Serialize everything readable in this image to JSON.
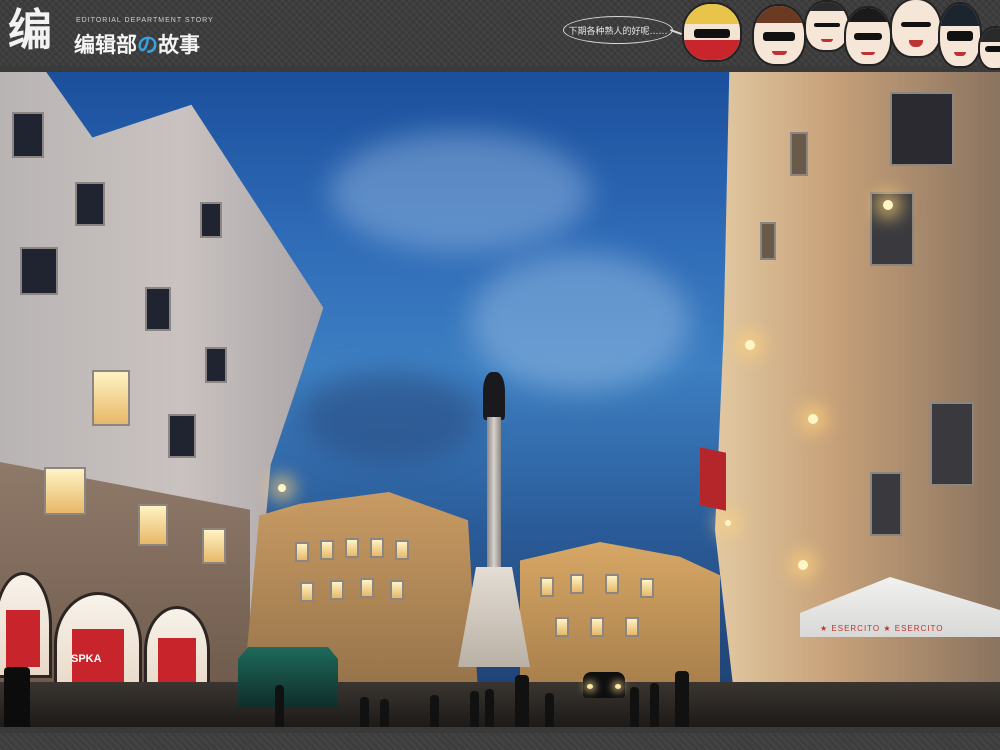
{
  "header": {
    "logo_glyph": "编",
    "logo_subtitle": "EDITORIAL DEPARTMENT STORY",
    "logo_name_part1": "编辑部",
    "logo_name_accent": "の",
    "logo_name_part2": "故事",
    "speech_bubble": "下期各种熟人的好呢……",
    "avatars": [
      {
        "name": "avatar-red-scarf-icon",
        "hair": "#e8c44a"
      },
      {
        "name": "avatar-glasses-woman-icon",
        "hair": "#6b3a22"
      },
      {
        "name": "avatar-crying-icon",
        "hair": "#2b2b2b"
      },
      {
        "name": "avatar-sunglasses-man-icon",
        "hair": "#1a1a1a"
      },
      {
        "name": "avatar-bald-man-icon",
        "hair": "#f3dac4"
      },
      {
        "name": "avatar-long-hair-icon",
        "hair": "#1c2430"
      },
      {
        "name": "avatar-partial-icon",
        "hair": "#2a2a2a"
      }
    ]
  },
  "photo": {
    "storefront_sign": "SPKA",
    "tent_banner": "★ ESERCITO   ★ ESERCITO"
  },
  "colors": {
    "frame": "#3d3d3d",
    "sky": "#2f6bb7",
    "logo_accent": "#3aa0e0"
  }
}
